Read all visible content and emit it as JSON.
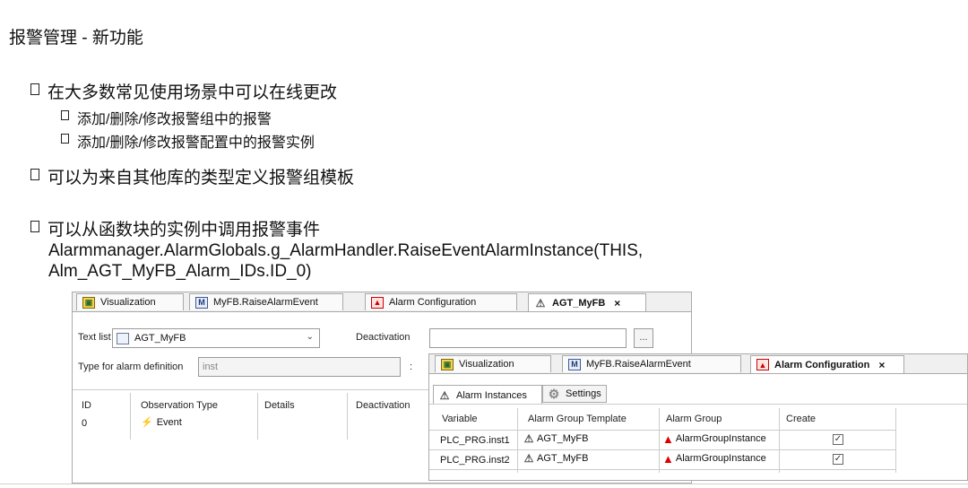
{
  "slide": {
    "title": "报警管理 - 新功能",
    "bullets": [
      "在大多数常见使用场景中可以在线更改",
      "添加/删除/修改报警组中的报警",
      "添加/删除/修改报警配置中的报警实例",
      "可以为来自其他库的类型定义报警组模板",
      "可以从函数块的实例中调用报警事件"
    ],
    "code_line1": "Alarmmanager.AlarmGlobals.g_AlarmHandler.RaiseEventAlarmInstance(THIS,",
    "code_line2": "Alm_AGT_MyFB_Alarm_IDs.ID_0)"
  },
  "editor1": {
    "tabs": [
      "Visualization",
      "MyFB.RaiseAlarmEvent",
      "Alarm Configuration",
      "AGT_MyFB"
    ],
    "text_list_label": "Text list",
    "text_list_value": "AGT_MyFB",
    "deactivation_label": "Deactivation",
    "deactivation_button": "...",
    "type_label": "Type for alarm definition",
    "type_value": "inst",
    "type_colon": ":",
    "columns": [
      "ID",
      "Observation Type",
      "Details",
      "Deactivation"
    ],
    "row": {
      "id": "0",
      "type": "Event"
    }
  },
  "editor2": {
    "tabs": [
      "Visualization",
      "MyFB.RaiseAlarmEvent",
      "Alarm Configuration"
    ],
    "subtabs": [
      "Alarm Instances",
      "Settings"
    ],
    "columns": [
      "Variable",
      "Alarm Group Template",
      "Alarm Group",
      "Create"
    ],
    "rows": [
      {
        "variable": "PLC_PRG.inst1",
        "template": "AGT_MyFB",
        "group": "AlarmGroupInstance",
        "create": true
      },
      {
        "variable": "PLC_PRG.inst2",
        "template": "AGT_MyFB",
        "group": "AlarmGroupInstance",
        "create": true
      }
    ]
  },
  "icons": {
    "close": "×",
    "dropdown": "⌄",
    "event": "⚡",
    "checked": "☑"
  }
}
